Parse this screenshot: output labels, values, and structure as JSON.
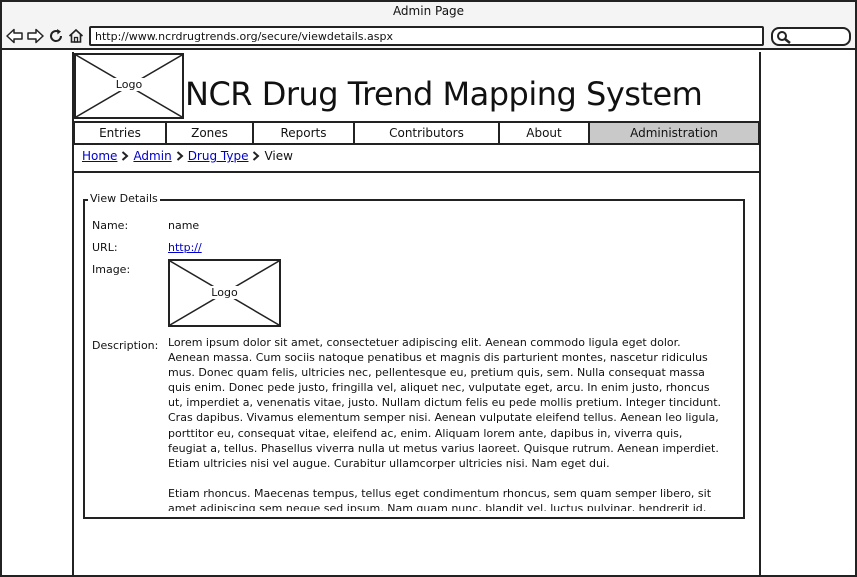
{
  "window": {
    "title": "Admin Page",
    "address": "http://www.ncrdrugtrends.org/secure/viewdetails.aspx"
  },
  "header": {
    "logo_label": "Logo",
    "site_title": "NCR Drug Trend Mapping System"
  },
  "nav": {
    "tabs": [
      {
        "label": "Entries"
      },
      {
        "label": "Zones"
      },
      {
        "label": "Reports"
      },
      {
        "label": "Contributors"
      },
      {
        "label": "About"
      },
      {
        "label": "Administration",
        "active": true
      }
    ]
  },
  "breadcrumb": {
    "items": [
      "Home",
      "Admin",
      "Drug Type"
    ],
    "current": "View"
  },
  "details": {
    "legend": "View Details",
    "name_label": "Name:",
    "name_value": "name",
    "url_label": "URL:",
    "url_value": "http://",
    "image_label": "Image:",
    "image_placeholder": "Logo",
    "description_label": "Description:",
    "description_paragraphs": [
      "Lorem ipsum dolor sit amet, consectetuer adipiscing elit. Aenean commodo ligula eget dolor. Aenean massa. Cum sociis natoque penatibus et magnis dis parturient montes, nascetur ridiculus mus. Donec quam felis, ultricies nec, pellentesque eu, pretium quis, sem. Nulla consequat massa quis enim. Donec pede justo, fringilla vel, aliquet nec, vulputate eget, arcu. In enim justo, rhoncus ut, imperdiet a, venenatis vitae, justo. Nullam dictum felis eu pede mollis pretium. Integer tincidunt. Cras dapibus. Vivamus elementum semper nisi. Aenean vulputate eleifend tellus. Aenean leo ligula, porttitor eu, consequat vitae, eleifend ac, enim. Aliquam lorem ante, dapibus in, viverra quis, feugiat a, tellus. Phasellus viverra nulla ut metus varius laoreet. Quisque rutrum. Aenean imperdiet. Etiam ultricies nisi vel augue. Curabitur ullamcorper ultricies nisi. Nam eget dui.",
      "Etiam rhoncus. Maecenas tempus, tellus eget condimentum rhoncus, sem quam semper libero, sit amet adipiscing sem neque sed ipsum. Nam quam nunc, blandit vel, luctus pulvinar, hendrerit id, lorem."
    ]
  },
  "icons": [
    "back-icon",
    "forward-icon",
    "reload-icon",
    "home-icon",
    "search-icon"
  ]
}
